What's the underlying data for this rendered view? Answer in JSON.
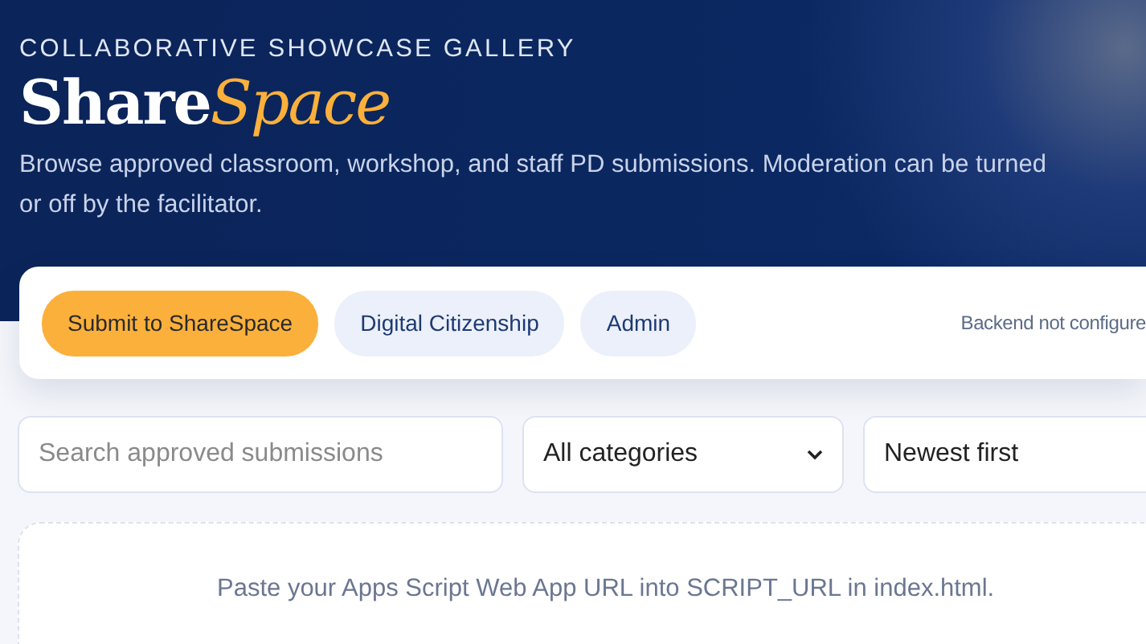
{
  "header": {
    "eyebrow": "COLLABORATIVE SHOWCASE GALLERY",
    "title": "Share",
    "title_accent": "Space",
    "description_lines": [
      "Browse approved classroom, workshop, and staff PD submissions. Moderation can be turned",
      "or off by the facilitator."
    ]
  },
  "toolbar": {
    "buttons": [
      {
        "label": "Submit to ShareSpace",
        "kind": "primary"
      },
      {
        "label": "Digital Citizenship",
        "kind": "secondary"
      },
      {
        "label": "Admin",
        "kind": "secondary"
      }
    ],
    "status": "Backend not configure"
  },
  "filters": {
    "search": {
      "placeholder": "Search approved submissions"
    },
    "category": {
      "value": "All categories"
    },
    "sort": {
      "value": "Newest first"
    }
  },
  "empty_state": {
    "message": "Paste your Apps Script Web App URL into SCRIPT_URL in index.html."
  }
}
